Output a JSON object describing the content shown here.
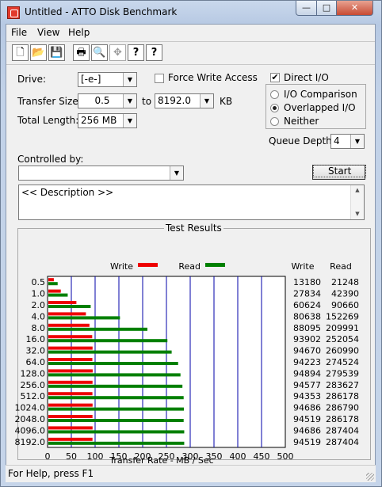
{
  "window": {
    "title": "Untitled - ATTO Disk Benchmark",
    "min_glyph": "—",
    "max_glyph": "□",
    "close_glyph": "✕"
  },
  "menu": [
    {
      "label": "File",
      "key": "F"
    },
    {
      "label": "View",
      "key": "V"
    },
    {
      "label": "Help",
      "key": "H"
    }
  ],
  "toolbar": {
    "new_glyph": "🗋",
    "open_glyph": "📂",
    "save_glyph": "💾",
    "print_glyph": "🖶",
    "preview_glyph": "🔍",
    "move_glyph": "✥",
    "help_glyph": "?",
    "whatsthis_glyph": "?"
  },
  "form": {
    "drive_label": "Drive:",
    "drive_value": "[-e-]",
    "force_write_label": "Force Write Access",
    "force_write_checked": false,
    "direct_io_label": "Direct I/O",
    "direct_io_checked": true,
    "direct_io_mark": "✔",
    "transfer_size_label": "Transfer Size:",
    "transfer_from": "0.5",
    "to_label": "to",
    "transfer_to": "8192.0",
    "kb_label": "KB",
    "total_length_label": "Total Length:",
    "total_length": "256 MB",
    "io_options": [
      {
        "label": "I/O Comparison",
        "selected": false
      },
      {
        "label": "Overlapped I/O",
        "selected": true
      },
      {
        "label": "Neither",
        "selected": false
      }
    ],
    "queue_depth_label": "Queue Depth:",
    "queue_depth": "4",
    "controlled_by_label": "Controlled by:",
    "controlled_by_value": "",
    "start_label": "Start",
    "description": "<< Description >>"
  },
  "results": {
    "group_title": "Test Results",
    "write_legend": "Write",
    "read_legend": "Read",
    "write_header": "Write",
    "read_header": "Read",
    "colors": {
      "write": "#ee0000",
      "read": "#008000",
      "grid": "#0000aa"
    }
  },
  "chart_data": {
    "type": "bar",
    "orientation": "horizontal",
    "xlabel": "Transfer Rate - MB / Sec",
    "xlim": [
      0,
      500
    ],
    "xticks": [
      0,
      50,
      100,
      150,
      200,
      250,
      300,
      350,
      400,
      450,
      500
    ],
    "categories": [
      "0.5",
      "1.0",
      "2.0",
      "4.0",
      "8.0",
      "16.0",
      "32.0",
      "64.0",
      "128.0",
      "256.0",
      "512.0",
      "1024.0",
      "2048.0",
      "4096.0",
      "8192.0"
    ],
    "series": [
      {
        "name": "Write",
        "values": [
          13180,
          27834,
          60624,
          80638,
          88095,
          93902,
          94670,
          94223,
          94894,
          94577,
          94353,
          94686,
          94519,
          94686,
          94519
        ]
      },
      {
        "name": "Read",
        "values": [
          21248,
          42390,
          90660,
          152269,
          209991,
          252054,
          260990,
          274524,
          279539,
          283627,
          286178,
          286790,
          286178,
          287404,
          287404
        ]
      }
    ],
    "value_unit_note": "values in KB/s as printed"
  },
  "statusbar": {
    "text": "For Help, press F1"
  }
}
